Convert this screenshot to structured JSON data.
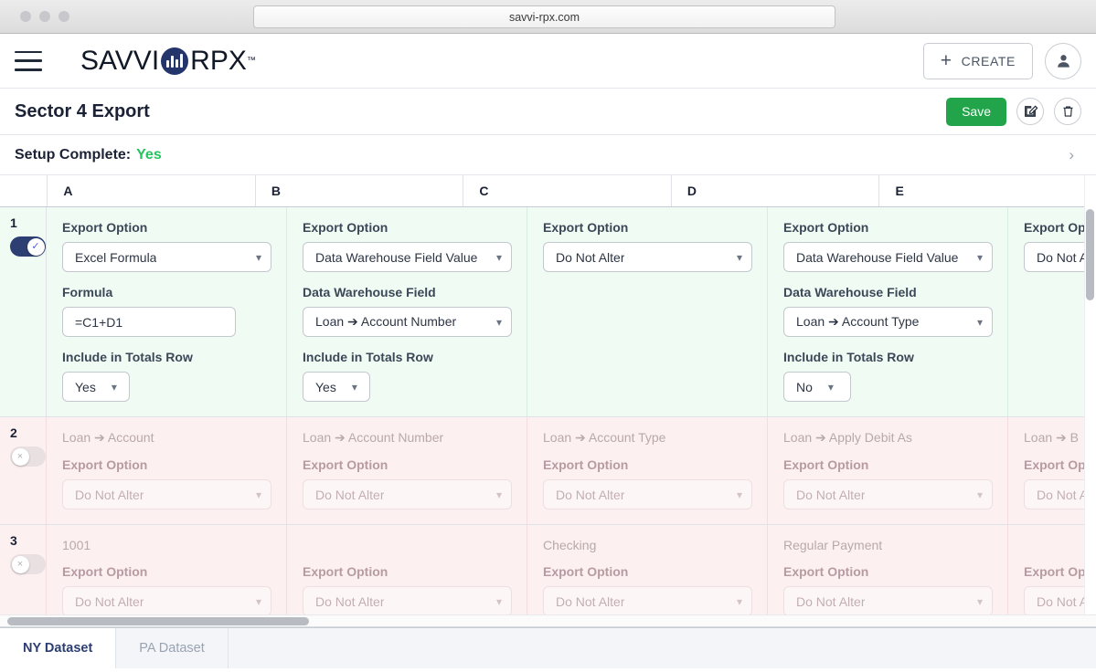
{
  "browser": {
    "url": "savvi-rpx.com"
  },
  "header": {
    "logo_left": "SAVVI",
    "logo_right": "RPX",
    "logo_tm": "™",
    "create_label": "CREATE",
    "plus_icon": "+"
  },
  "title_bar": {
    "title": "Sector 4 Export",
    "save_label": "Save"
  },
  "setup": {
    "label": "Setup Complete:",
    "value": "Yes",
    "chevron": "›"
  },
  "grid": {
    "columns": [
      "A",
      "B",
      "C",
      "D",
      "E"
    ],
    "rows": [
      {
        "number": "1",
        "enabled": true,
        "toggle_glyph": "✓",
        "cells": [
          {
            "value": null,
            "export_label": "Export Option",
            "export_value": "Excel Formula",
            "second_label": "Formula",
            "second_value": "=C1+D1",
            "second_type": "input",
            "totals_label": "Include in Totals Row",
            "totals_value": "Yes"
          },
          {
            "value": null,
            "export_label": "Export Option",
            "export_value": "Data Warehouse Field Value",
            "second_label": "Data Warehouse Field",
            "second_value": "Loan ➔ Account Number",
            "second_type": "select",
            "totals_label": "Include in Totals Row",
            "totals_value": "Yes"
          },
          {
            "value": null,
            "export_label": "Export Option",
            "export_value": "Do Not Alter",
            "second_label": null,
            "second_value": null,
            "second_type": null,
            "totals_label": null,
            "totals_value": null
          },
          {
            "value": null,
            "export_label": "Export Option",
            "export_value": "Data Warehouse Field Value",
            "second_label": "Data Warehouse Field",
            "second_value": "Loan ➔ Account Type",
            "second_type": "select",
            "totals_label": "Include in Totals Row",
            "totals_value": "No"
          },
          {
            "value": null,
            "export_label": "Export Option",
            "export_value": "Do Not Alter",
            "second_label": null,
            "second_value": null,
            "second_type": null,
            "totals_label": null,
            "totals_value": null
          }
        ]
      },
      {
        "number": "2",
        "enabled": false,
        "toggle_glyph": "×",
        "cells": [
          {
            "value": "Loan ➔ Account",
            "export_label": "Export Option",
            "export_value": "Do Not Alter"
          },
          {
            "value": "Loan ➔ Account Number",
            "export_label": "Export Option",
            "export_value": "Do Not Alter"
          },
          {
            "value": "Loan ➔ Account Type",
            "export_label": "Export Option",
            "export_value": "Do Not Alter"
          },
          {
            "value": "Loan ➔ Apply Debit As",
            "export_label": "Export Option",
            "export_value": "Do Not Alter"
          },
          {
            "value": "Loan ➔ B",
            "export_label": "Export Option",
            "export_value": "Do Not Alter"
          }
        ]
      },
      {
        "number": "3",
        "enabled": false,
        "toggle_glyph": "×",
        "cells": [
          {
            "value": "1001",
            "export_label": "Export Option",
            "export_value": "Do Not Alter"
          },
          {
            "value": null,
            "export_label": "Export Option",
            "export_value": "Do Not Alter"
          },
          {
            "value": "Checking",
            "export_label": "Export Option",
            "export_value": "Do Not Alter"
          },
          {
            "value": "Regular Payment",
            "export_label": "Export Option",
            "export_value": "Do Not Alter"
          },
          {
            "value": null,
            "export_label": "Export Option",
            "export_value": "Do Not Alter"
          }
        ]
      }
    ]
  },
  "tabs": [
    {
      "label": "NY Dataset",
      "active": true
    },
    {
      "label": "PA Dataset",
      "active": false
    }
  ],
  "colors": {
    "brand_navy": "#2c3e72",
    "save_green": "#22a44b",
    "status_green": "#22c55e",
    "row_enabled_bg": "#f0fbf4",
    "row_disabled_bg": "#fdf0f1"
  }
}
